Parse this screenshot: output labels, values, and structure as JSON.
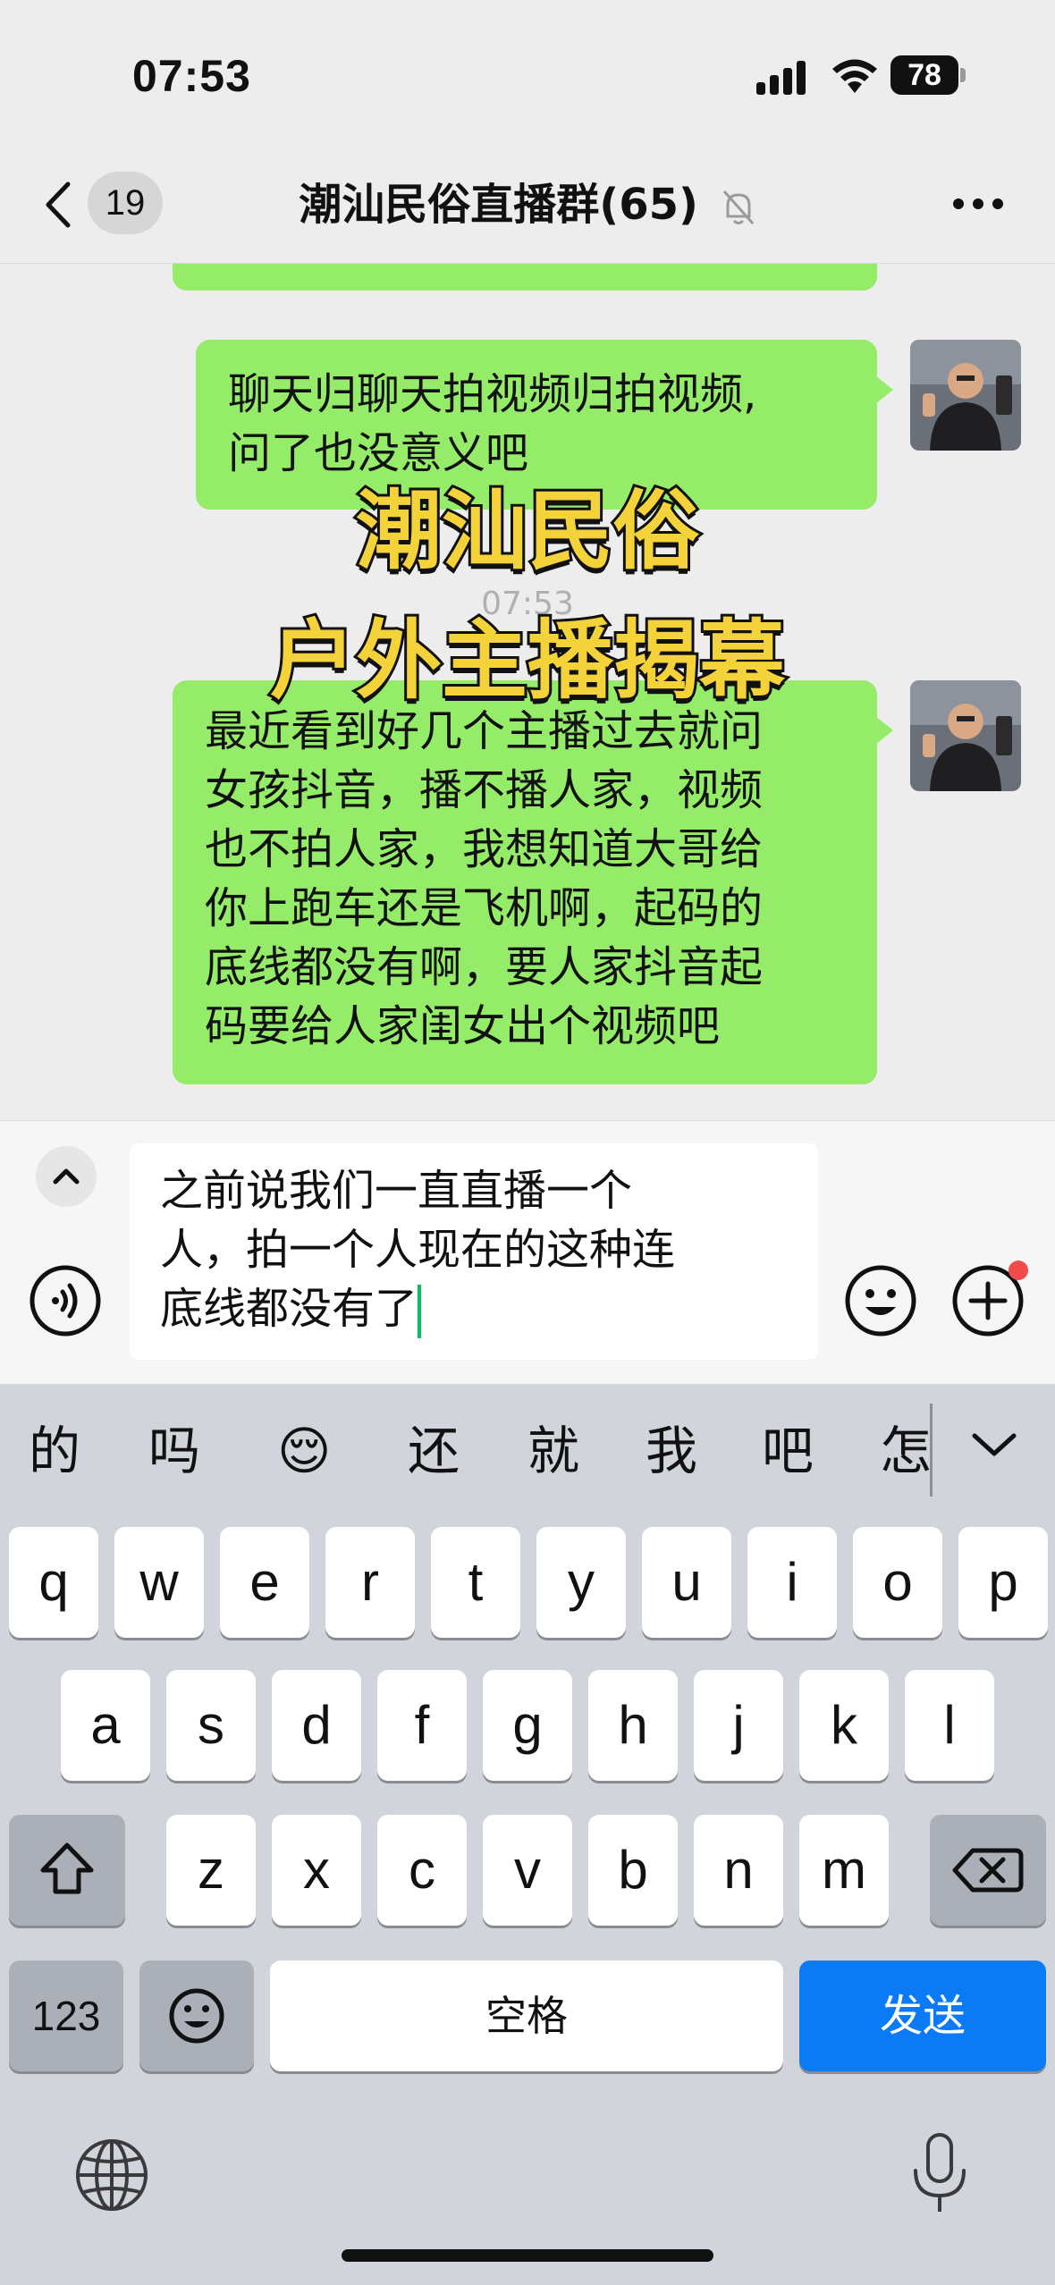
{
  "status_bar": {
    "time": "07:53",
    "battery": "78"
  },
  "nav": {
    "unread_count": "19",
    "title": "潮汕民俗直播群(65)"
  },
  "messages": [
    {
      "lines": [
        "聊天归聊天拍视频归拍视频,",
        "问了也没意义吧"
      ]
    },
    {
      "lines": [
        "最近看到好几个主播过去就问",
        "女孩抖音，播不播人家，视频",
        "也不拍人家，我想知道大哥给",
        "你上跑车还是飞机啊，起码的",
        "底线都没有啊，要人家抖音起",
        "码要给人家闺女出个视频吧"
      ]
    }
  ],
  "timestamp": "07:53",
  "overlay": {
    "line1": "潮汕民俗",
    "line2": "户外主播揭幕"
  },
  "input": {
    "lines": [
      "之前说我们一直直播一个",
      "人，拍一个人现在的这种连",
      "底线都没有了"
    ]
  },
  "keyboard": {
    "candidates": [
      "的",
      "吗",
      "😌",
      "还",
      "就",
      "我",
      "吧",
      "怎"
    ],
    "row1": [
      "q",
      "w",
      "e",
      "r",
      "t",
      "y",
      "u",
      "i",
      "o",
      "p"
    ],
    "row2": [
      "a",
      "s",
      "d",
      "f",
      "g",
      "h",
      "j",
      "k",
      "l"
    ],
    "row3": [
      "z",
      "x",
      "c",
      "v",
      "b",
      "n",
      "m"
    ],
    "numbers_label": "123",
    "space_label": "空格",
    "send_label": "发送"
  },
  "colors": {
    "bubble": "#95ec69",
    "send_key": "#0a7bf5",
    "caret": "#07c160"
  },
  "icons": [
    "signal-icon",
    "wifi-icon",
    "battery-icon",
    "back-chevron-icon",
    "mute-bell-icon",
    "more-icon",
    "voice-icon",
    "emoji-icon",
    "plus-icon",
    "shift-icon",
    "delete-icon",
    "globe-icon",
    "mic-icon"
  ]
}
